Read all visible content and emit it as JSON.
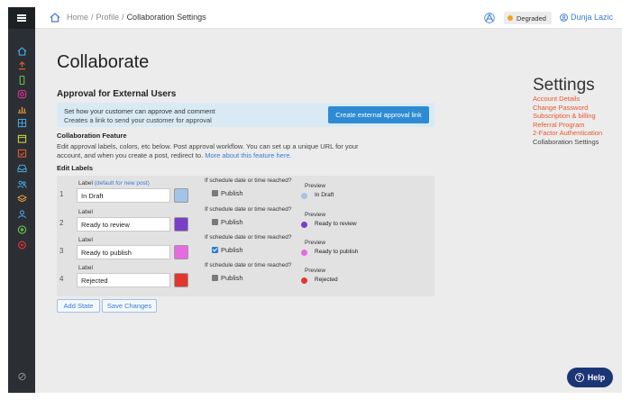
{
  "colors": {
    "sidebar_bg": "#2b2f33",
    "accent": "#2e8bd3",
    "link": "#3a7bd5",
    "settings_link": "#e8582f",
    "status_degraded": "#f4a023",
    "help_bg": "#1c3575"
  },
  "topbar": {
    "breadcrumbs": [
      "Home",
      "Profile",
      "Collaboration Settings"
    ],
    "status": "Degraded",
    "user": "Dunja Lazic"
  },
  "sidebar": {
    "icons": [
      "home-icon",
      "upload-icon",
      "phone-icon",
      "instagram-icon",
      "chart-icon",
      "grid-icon",
      "calendar-icon",
      "calendar-check-icon",
      "inbox-icon",
      "people-icon",
      "layers-icon",
      "user-icon",
      "check-circle-icon",
      "settings-icon",
      "slash-icon"
    ]
  },
  "main": {
    "title": "Collaborate",
    "approval_heading": "Approval for External Users",
    "external": {
      "line1": "Set how your customer can approve and comment",
      "line2": "Creates a link to send your customer for approval",
      "button": "Create external approval link"
    },
    "collab_heading": "Collaboration Feature",
    "collab_desc": "Edit approval labels, colors, etc below. Post approval workflow. You can set up a unique URL for your account, and when you create a post, redirect to. ",
    "collab_link": "More about this feature here.",
    "edit_heading": "Edit Labels",
    "label_caption": "Label",
    "label_hint": "(default for new post)",
    "schedule_question": "If schedule date or time reached?",
    "publish_label": "Publish",
    "preview_caption": "Preview",
    "labels": [
      {
        "num": "1",
        "value": "In Draft",
        "color": "#a3c4e8",
        "publish": false
      },
      {
        "num": "2",
        "value": "Ready to review",
        "color": "#7a3fc9",
        "publish": false
      },
      {
        "num": "3",
        "value": "Ready to publish",
        "color": "#e66be0",
        "publish": true
      },
      {
        "num": "4",
        "value": "Rejected",
        "color": "#e2372f",
        "publish": false
      }
    ],
    "add_state": "Add State",
    "save_changes": "Save Changes"
  },
  "settings": {
    "title": "Settings",
    "items": [
      "Account Details",
      "Change Password",
      "Subscription & billing",
      "Referral Program",
      "2-Factor Authentication",
      "Collaboration Settings"
    ],
    "active": "Collaboration Settings"
  },
  "help": "Help"
}
